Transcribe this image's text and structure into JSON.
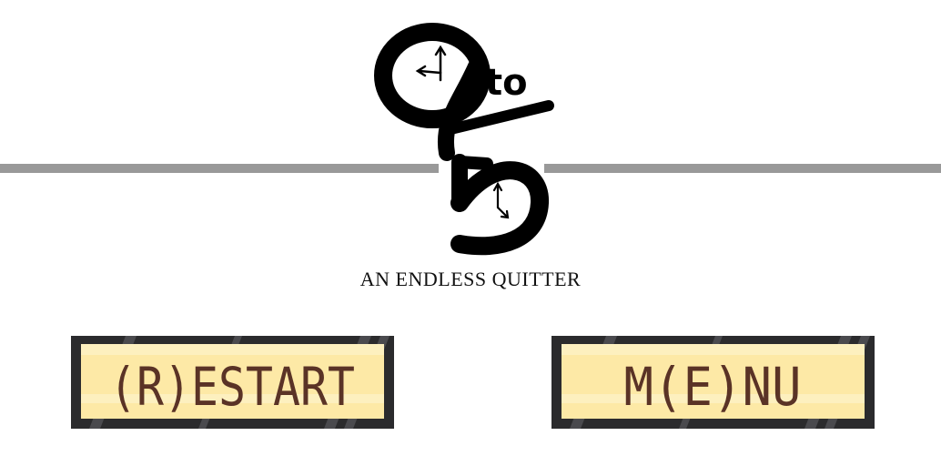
{
  "logo": {
    "number_top": "9",
    "word": "to",
    "number_bottom": "5"
  },
  "subtitle": "AN ENDLESS QUITTER",
  "buttons": {
    "restart_label": "(R)ESTART",
    "menu_label": "M(E)NU"
  },
  "colors": {
    "frame": "#2b2b2d",
    "screen": "#fde9a6",
    "screen_band": "#fdf0bf",
    "lcd_text": "#5a3326",
    "divider": "#999999"
  }
}
